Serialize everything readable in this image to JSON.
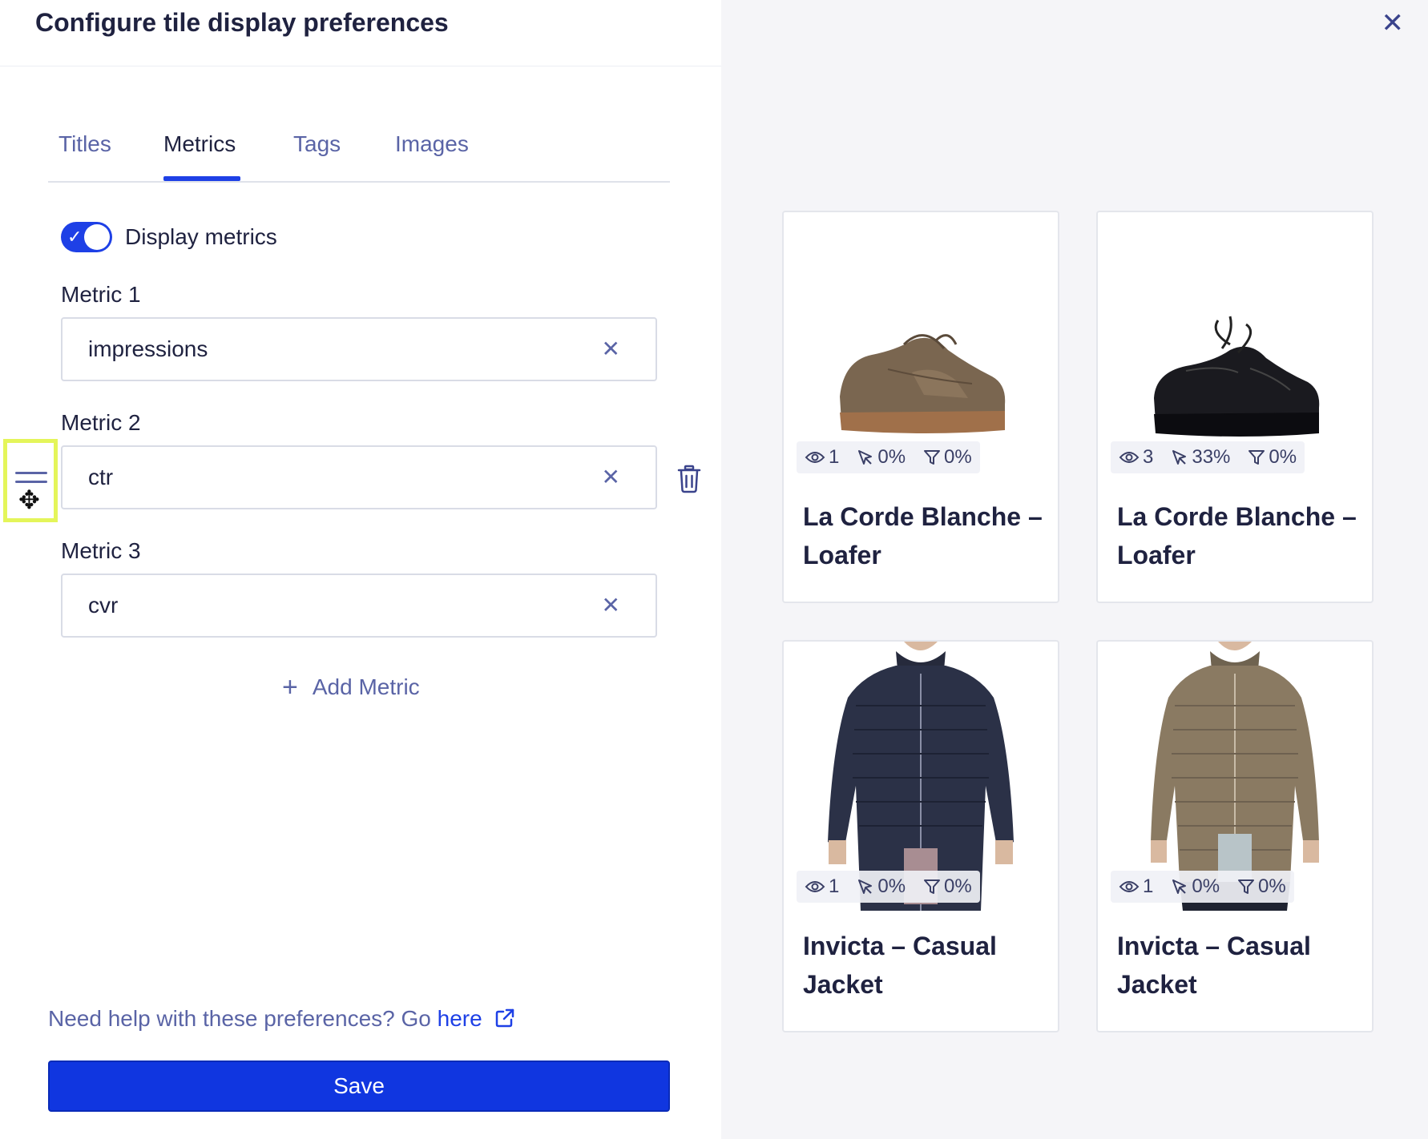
{
  "header": {
    "title": "Configure tile display preferences"
  },
  "tabs": [
    {
      "label": "Titles"
    },
    {
      "label": "Metrics"
    },
    {
      "label": "Tags"
    },
    {
      "label": "Images"
    }
  ],
  "active_tab": "Metrics",
  "display_metrics": {
    "label": "Display metrics",
    "enabled": true
  },
  "metrics": [
    {
      "label": "Metric 1",
      "value": "impressions"
    },
    {
      "label": "Metric 2",
      "value": "ctr"
    },
    {
      "label": "Metric 3",
      "value": "cvr"
    }
  ],
  "add_metric_label": "Add Metric",
  "help": {
    "text": "Need help with these preferences? Go ",
    "link_text": "here"
  },
  "save_label": "Save",
  "colors": {
    "accent": "#1e40e6",
    "drag_highlight": "#e4f55a",
    "muted": "#5a64a6"
  },
  "tiles": [
    {
      "title": "La Corde Blanche – Loafer",
      "impressions": "1",
      "ctr": "0%",
      "cvr": "0%",
      "image": "brown-shoe"
    },
    {
      "title": "La Corde Blanche – Loafer",
      "impressions": "3",
      "ctr": "33%",
      "cvr": "0%",
      "image": "black-shoe"
    },
    {
      "title": "Invicta – Casual Jacket",
      "impressions": "1",
      "ctr": "0%",
      "cvr": "0%",
      "image": "navy-jacket"
    },
    {
      "title": "Invicta – Casual Jacket",
      "impressions": "1",
      "ctr": "0%",
      "cvr": "0%",
      "image": "olive-jacket"
    }
  ]
}
